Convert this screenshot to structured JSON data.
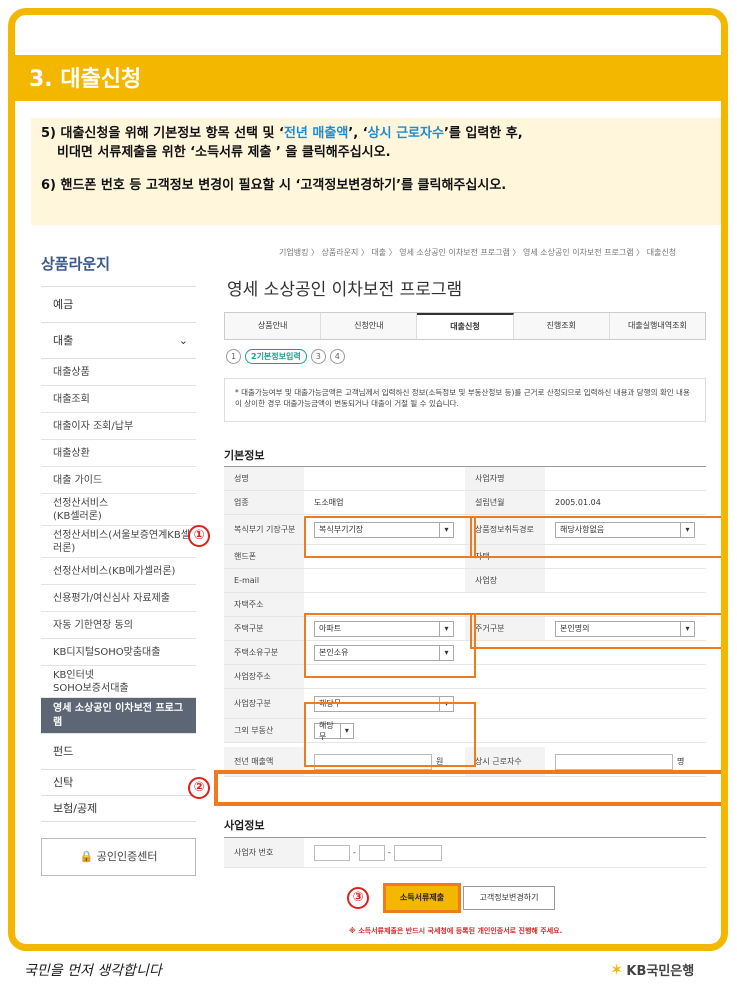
{
  "header": {
    "title": "3. 대출신청"
  },
  "instructions": {
    "line1_a": "5) 대출신청을 위해 기본정보 항목 선택 및 ‘",
    "line1_hl1": "전년 매출액",
    "line1_b": "’, ‘",
    "line1_hl2": "상시 근로자수",
    "line1_c": "’를 입력한 후,",
    "line2": "비대면 서류제출을 위한 ‘소득서류 제출 ’ 을 클릭해주십시오.",
    "line3": "6) 핸드폰 번호 등 고객정보 변경이 필요할 시 ‘고객정보변경하기’를 클릭해주십시오."
  },
  "breadcrumb": "기업뱅킹 〉 상품라운지 〉 대출 〉 영세 소상공인 이차보전 프로그램 〉 영세 소상공인 이차보전 프로그램 〉 대출신청",
  "sidebar": {
    "title": "상품라운지",
    "deposit": "예금",
    "loan": "대출",
    "items": [
      "대출상품",
      "대출조회",
      "대출이자 조회/납부",
      "대출상환",
      "대출 가이드",
      "선정산서비스\n(KB셀러론)",
      "선정산서비스(서울보증연계KB셀\n러론)",
      "선정산서비스(KB메가셀러론)",
      "신용평가/여신심사 자료제출",
      "자동 기한연장 동의",
      "KB디지털SOHO맞춤대출",
      "KB인터넷\nSOHO보증서대출",
      "영세 소상공인 이차보전 프로그\n램"
    ],
    "fund": "펀드",
    "trust": "신탁",
    "insurance": "보험/공제",
    "cert": "공인인증센터"
  },
  "page_title": "영세 소상공인 이차보전 프로그램",
  "tabs": [
    "상품안내",
    "신청안내",
    "대출신청",
    "진행조회",
    "대출실행내역조회"
  ],
  "steps": [
    "1",
    "2기본정보입력",
    "3",
    "4"
  ],
  "notice": "* 대출가능여부 및 대출가능금액은 고객님께서 입력하신 정보(소득정보 및 부동산정보 등)를 근거로 산정되므로 입력하신 내용과 당행의 확인 내용이 상이한 경우 대출가능금액이 변동되거나 대출이 거절 될 수 있습니다.",
  "basic": {
    "title": "기본정보",
    "name_label": "성명",
    "bizname_label": "사업자명",
    "industry_label": "업종",
    "industry_value": "도소매업",
    "founded_label": "설립년월",
    "founded_value": "2005.01.04",
    "bookkeep_label": "복식부기 기장구분",
    "bookkeep_value": "복식부기기장",
    "property_label": "상품정보취득경로",
    "property_value": "해당사항없음",
    "phone_label": "핸드폰",
    "homephone_label": "자택",
    "email_label": "E-mail",
    "bizsite_label": "사업장",
    "address_label": "자택주소",
    "housetype_label": "주택구분",
    "housetype_value": "아파트",
    "residence_label": "주거구분",
    "residence_value": "본인명의",
    "houseowner_label": "주택소유구분",
    "houseowner_value": "본인소유",
    "bizaddr_label": "사업장주소",
    "biztype_label": "사업장구분",
    "biztype_value": "해당무",
    "otherestate_label": "그외 부동산",
    "otherestate_value": "해당무",
    "sales_label": "전년 매출액",
    "sales_unit": "원",
    "workers_label": "상시 근로자수",
    "workers_unit": "명"
  },
  "biz": {
    "title": "사업정보",
    "regno_label": "사업자 번호",
    "dash": "-"
  },
  "markers": [
    "①",
    "②",
    "③"
  ],
  "buttons": {
    "submit": "소득서류제출",
    "change": "고객정보변경하기"
  },
  "warning": "※ 소득서류제출은 반드시 국세청에 등록된 개인인증서로 진행해 주세요.",
  "footer": {
    "slogan": "국민을 먼저 생각합니다",
    "brand": "KB국민은행"
  },
  "colors": {
    "accent": "#f3b700",
    "highlight": "#f07a1c",
    "marker": "#e0201c"
  }
}
